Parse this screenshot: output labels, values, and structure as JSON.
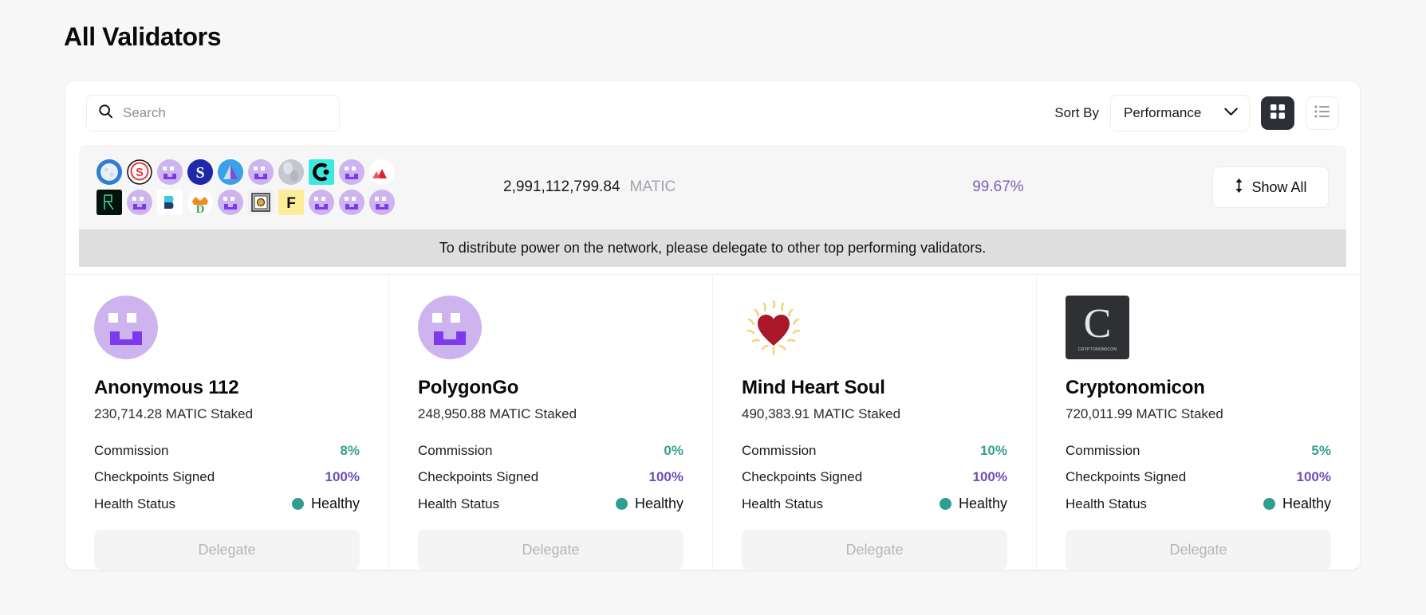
{
  "page": {
    "title": "All Validators"
  },
  "toolbar": {
    "search_placeholder": "Search",
    "search_value": "",
    "sort_label": "Sort By",
    "sort_selected": "Performance",
    "sort_options": [
      "Performance"
    ],
    "grid_view_label": "Grid view",
    "list_view_label": "List view"
  },
  "summary": {
    "amount": "2,991,112,799.84",
    "unit": "MATIC",
    "performance": "99.67%",
    "show_all_label": "Show All",
    "avatars": [
      {
        "kind": "moon",
        "bg": "#2d7fd6"
      },
      {
        "kind": "s-red",
        "bg": "#ffffff"
      },
      {
        "kind": "face",
        "bg": "#cdb4ef"
      },
      {
        "kind": "s-blue",
        "bg": "#1d29a8"
      },
      {
        "kind": "arrow",
        "bg": "#3aa0e8"
      },
      {
        "kind": "face",
        "bg": "#cdb4ef"
      },
      {
        "kind": "orb",
        "bg": "#b9bcc4"
      },
      {
        "kind": "c-cyan",
        "bg": "#3ee8e0"
      },
      {
        "kind": "face",
        "bg": "#cdb4ef"
      },
      {
        "kind": "peaks",
        "bg": "#ffffff"
      },
      {
        "kind": "r-dark",
        "bg": "#05110d"
      },
      {
        "kind": "face",
        "bg": "#cdb4ef"
      },
      {
        "kind": "d-blue",
        "bg": "#ffffff"
      },
      {
        "kind": "crown",
        "bg": "#ffffff"
      },
      {
        "kind": "face",
        "bg": "#cdb4ef"
      },
      {
        "kind": "safe",
        "bg": "#ffffff"
      },
      {
        "kind": "f-yellow",
        "bg": "#fdec9a"
      },
      {
        "kind": "face",
        "bg": "#cdb4ef"
      },
      {
        "kind": "face",
        "bg": "#cdb4ef"
      },
      {
        "kind": "face",
        "bg": "#cdb4ef"
      }
    ]
  },
  "notice": {
    "text": "To distribute power on the network, please delegate to other top performing validators."
  },
  "labels": {
    "commission": "Commission",
    "checkpoints": "Checkpoints Signed",
    "health": "Health Status",
    "delegate": "Delegate"
  },
  "colors": {
    "commission": "#36a08f",
    "checkpoints": "#6c4fb8",
    "health_dot": "#2f9e8f",
    "performance": "#7b61b5",
    "notice_bg": "#dededf"
  },
  "validators": [
    {
      "name": "Anonymous 112",
      "staked": "230,714.28 MATIC Staked",
      "commission": "8%",
      "checkpoints": "100%",
      "health": "Healthy",
      "logo": "pixel-face-avatar",
      "delegate": "Delegate"
    },
    {
      "name": "PolygonGo",
      "staked": "248,950.88 MATIC Staked",
      "commission": "0%",
      "checkpoints": "100%",
      "health": "Healthy",
      "logo": "pixel-face-avatar",
      "delegate": "Delegate"
    },
    {
      "name": "Mind Heart Soul",
      "staked": "490,383.91 MATIC Staked",
      "commission": "10%",
      "checkpoints": "100%",
      "health": "Healthy",
      "logo": "radiant-heart-logo",
      "delegate": "Delegate"
    },
    {
      "name": "Cryptonomicon",
      "staked": "720,011.99 MATIC Staked",
      "commission": "5%",
      "checkpoints": "100%",
      "health": "Healthy",
      "logo": "cryptonomicon-logo",
      "logo_caption": "CRYPTONOMICON",
      "logo_letter": "C",
      "delegate": "Delegate"
    }
  ]
}
